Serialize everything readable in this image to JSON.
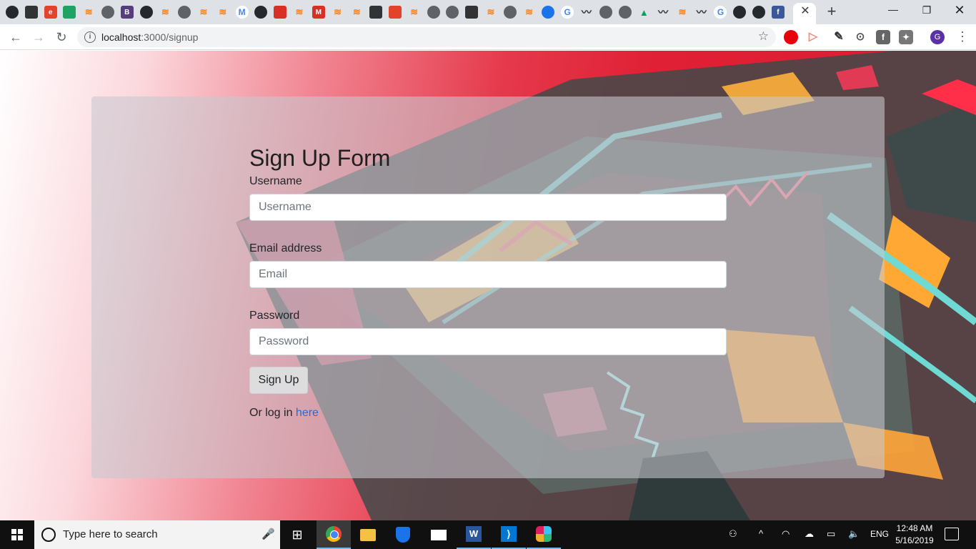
{
  "browser": {
    "tab_close_glyph": "✕",
    "new_tab_glyph": "+",
    "window_controls": {
      "minimize": "—",
      "maximize": "❐",
      "close": "✕"
    },
    "nav": {
      "back": "←",
      "forward": "→",
      "reload": "↻"
    },
    "url_host": "localhost",
    "url_path": ":3000/signup",
    "avatar_letter": "G",
    "menu_glyph": "⋮",
    "tab_favicons": [
      "github-icon",
      "cube-icon",
      "e-icon",
      "shield-icon",
      "stackoverflow-icon",
      "globe-icon",
      "bootstrap-icon",
      "github-icon",
      "stackoverflow-icon",
      "globe-icon",
      "stackoverflow-icon",
      "stackoverflow-icon",
      "gmail-icon",
      "github-icon",
      "cookie-icon",
      "stackoverflow-icon",
      "m-icon",
      "stackoverflow-icon",
      "stackoverflow-icon",
      "cup-icon",
      "gitlab-icon",
      "stackoverflow-icon",
      "eye-icon",
      "globe-icon",
      "trello-icon",
      "stackoverflow-icon",
      "globe-icon",
      "stackoverflow-icon",
      "messenger-icon",
      "google-icon",
      "mustache-icon",
      "globe-icon",
      "globe-icon",
      "drive-icon",
      "mustache-icon",
      "stackoverflow-icon",
      "mustache-icon",
      "google-icon",
      "github-icon",
      "github-icon",
      "facebook-icon"
    ]
  },
  "form": {
    "title": "Sign Up Form",
    "username_label": "Username",
    "username_placeholder": "Username",
    "email_label": "Email address",
    "email_placeholder": "Email",
    "password_label": "Password",
    "password_placeholder": "Password",
    "submit_label": "Sign Up",
    "login_prefix": "Or log in ",
    "login_link": "here"
  },
  "taskbar": {
    "search_placeholder": "Type here to search",
    "mic_glyph": "🎤",
    "language": "ENG",
    "time": "12:48 AM",
    "date": "5/16/2019",
    "tray_up_glyph": "^",
    "task_view_glyph": "⊞"
  },
  "colors": {
    "brand_red": "#e02035",
    "link": "#1a6fe0",
    "taskbar_bg": "#101010"
  }
}
